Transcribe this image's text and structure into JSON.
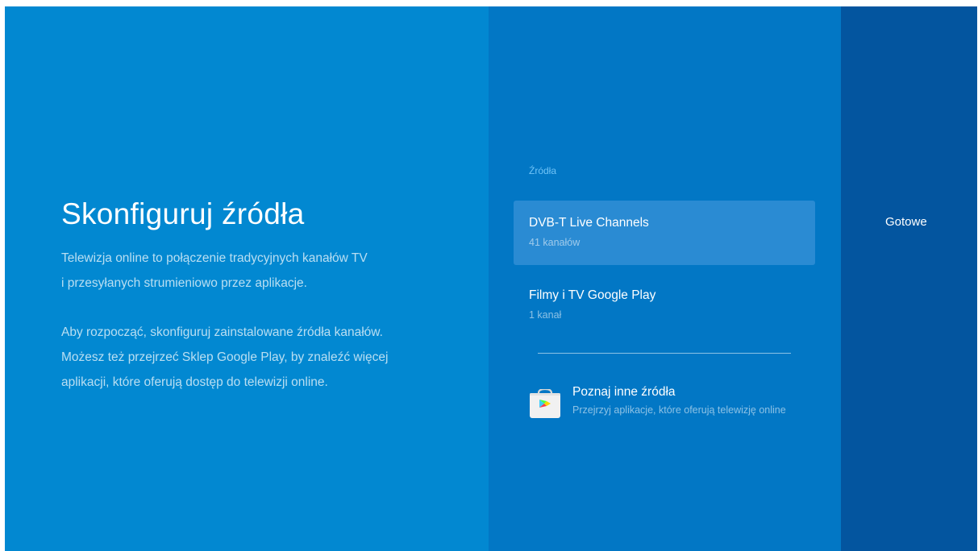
{
  "setup": {
    "title": "Skonfiguruj źródła",
    "description_1": [
      "Telewizja online to połączenie tradycyjnych kanałów TV",
      "i przesyłanych strumieniowo przez aplikacje."
    ],
    "description_2": [
      "Aby rozpocząć, skonfiguruj zainstalowane źródła kanałów.",
      "Możesz też przejrzeć Sklep Google Play, by znaleźć więcej",
      "aplikacji, które oferują dostęp do telewizji online."
    ]
  },
  "sources": {
    "section_label": "Źródła",
    "items": [
      {
        "title": "DVB-T Live Channels",
        "subtitle": "41 kanałów",
        "focused": true
      },
      {
        "title": "Filmy i TV Google Play",
        "subtitle": "1 kanał",
        "focused": false
      }
    ],
    "more": {
      "title": "Poznaj inne źródła",
      "subtitle": "Przejrzyj aplikacje, które oferują telewizję online",
      "icon": "google-play-store-icon"
    }
  },
  "actions": {
    "done_label": "Gotowe"
  },
  "colors": {
    "left_panel": "#0288d1",
    "middle_panel": "#0277c5",
    "right_panel": "#03559f",
    "focused_item": "#2a8bd3",
    "section_label": "#6fc3f7"
  }
}
